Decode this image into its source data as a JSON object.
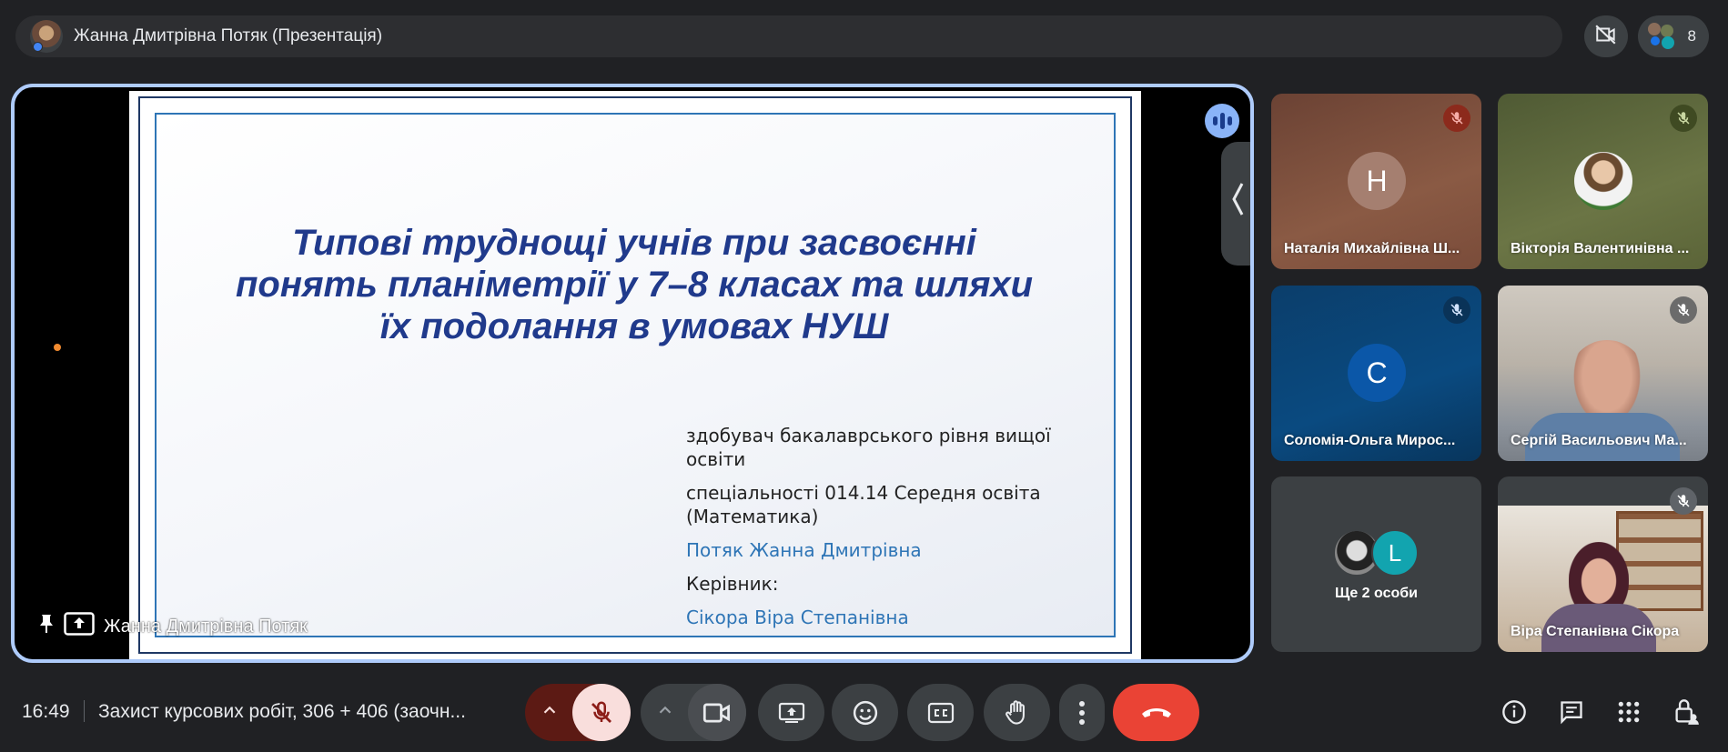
{
  "topbar": {
    "presenter_title": "Жанна Дмитрівна Потяк (Презентація)",
    "participant_count": "8"
  },
  "stage": {
    "caption": "Жанна Дмитрівна Потяк",
    "slide": {
      "title_lines": [
        "Типові труднощі учнів при засвоєнні",
        "понять планіметрії у 7–8 класах та шляхи",
        "їх подолання в умовах НУШ"
      ],
      "line1": "здобувач бакалаврського рівня вищої освіти",
      "line2": "спеціальності 014.14 Середня освіта (Математика)",
      "line3": "Потяк Жанна Дмитрівна",
      "line4": "Керівник:",
      "line5": "Сікора Віра Степанівна"
    }
  },
  "tiles": [
    {
      "name": "Наталія Михайлівна Ш...",
      "letter": "Н",
      "muted": true
    },
    {
      "name": "Вікторія Валентинівна ...",
      "letter": "",
      "muted": true
    },
    {
      "name": "Соломія-Ольга Мирос...",
      "letter": "С",
      "muted": true
    },
    {
      "name": "Сергій Васильович Ма...",
      "letter": "",
      "muted": true
    },
    {
      "name": "Ще 2 особи",
      "letter": "L",
      "muted": false
    },
    {
      "name": "Віра Степанівна Сікора",
      "letter": "",
      "muted": true
    }
  ],
  "bottombar": {
    "time": "16:49",
    "meeting_title": "Захист курсових робіт, 306 + 406 (заочн..."
  },
  "colors": {
    "background": "#202124",
    "stage_border": "#aecbfa",
    "mic_off_bg": "#f9dedc",
    "mic_off_icon": "#8c1d18",
    "end_call": "#ea4335",
    "slide_title": "#203a8c",
    "slide_blue": "#2e75b6"
  }
}
